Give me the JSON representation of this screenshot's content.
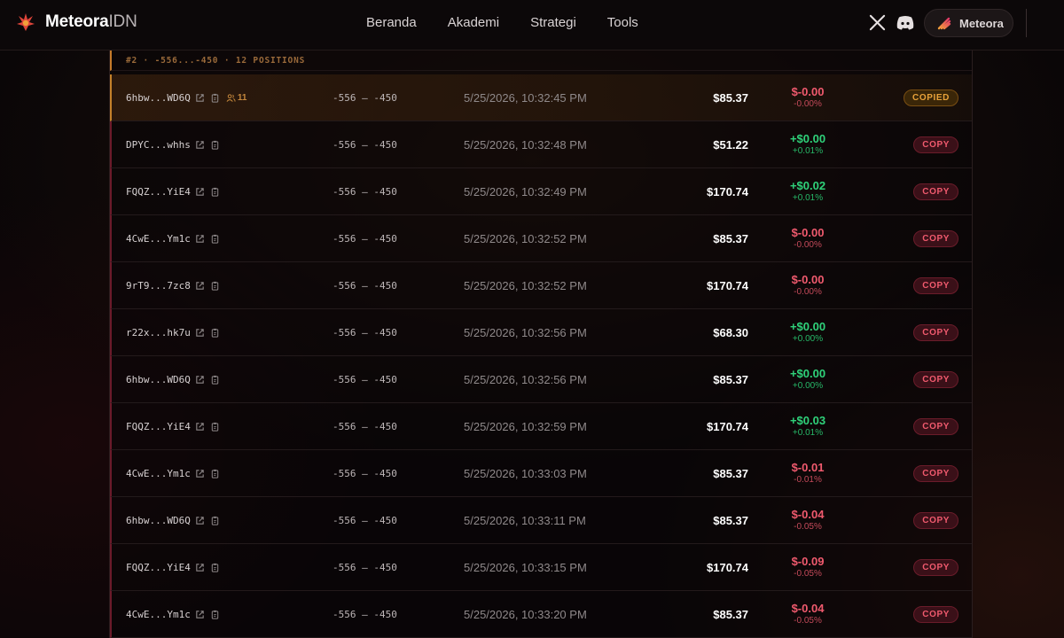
{
  "header": {
    "logo_text": "Meteora",
    "logo_suffix": "IDN",
    "nav": [
      "Beranda",
      "Akademi",
      "Strategi",
      "Tools"
    ],
    "social": [
      "x-icon",
      "discord-icon"
    ],
    "connect_label": "Meteora"
  },
  "group": {
    "label": "#2 · -556...-450 · 12 POSITIONS"
  },
  "colors": {
    "negative": "#f05a6e",
    "positive": "#2fd27a",
    "copied": "#e9a23a",
    "accent_orange": "#c4812a"
  },
  "rows": [
    {
      "wallet": "6hbw...WD6Q",
      "copiers": "11",
      "range": "-556 — -450",
      "time": "5/25/2026, 10:32:45 PM",
      "value": "$85.37",
      "pnl": "$-0.00",
      "pnl_pct": "-0.00%",
      "sign": "neg",
      "button": "COPIED"
    },
    {
      "wallet": "DPYC...whhs",
      "range": "-556 — -450",
      "time": "5/25/2026, 10:32:48 PM",
      "value": "$51.22",
      "pnl": "+$0.00",
      "pnl_pct": "+0.01%",
      "sign": "pos",
      "button": "COPY"
    },
    {
      "wallet": "FQQZ...YiE4",
      "range": "-556 — -450",
      "time": "5/25/2026, 10:32:49 PM",
      "value": "$170.74",
      "pnl": "+$0.02",
      "pnl_pct": "+0.01%",
      "sign": "pos",
      "button": "COPY"
    },
    {
      "wallet": "4CwE...Ym1c",
      "range": "-556 — -450",
      "time": "5/25/2026, 10:32:52 PM",
      "value": "$85.37",
      "pnl": "$-0.00",
      "pnl_pct": "-0.00%",
      "sign": "neg",
      "button": "COPY"
    },
    {
      "wallet": "9rT9...7zc8",
      "range": "-556 — -450",
      "time": "5/25/2026, 10:32:52 PM",
      "value": "$170.74",
      "pnl": "$-0.00",
      "pnl_pct": "-0.00%",
      "sign": "neg",
      "button": "COPY"
    },
    {
      "wallet": "r22x...hk7u",
      "range": "-556 — -450",
      "time": "5/25/2026, 10:32:56 PM",
      "value": "$68.30",
      "pnl": "+$0.00",
      "pnl_pct": "+0.00%",
      "sign": "pos",
      "button": "COPY"
    },
    {
      "wallet": "6hbw...WD6Q",
      "range": "-556 — -450",
      "time": "5/25/2026, 10:32:56 PM",
      "value": "$85.37",
      "pnl": "+$0.00",
      "pnl_pct": "+0.00%",
      "sign": "pos",
      "button": "COPY"
    },
    {
      "wallet": "FQQZ...YiE4",
      "range": "-556 — -450",
      "time": "5/25/2026, 10:32:59 PM",
      "value": "$170.74",
      "pnl": "+$0.03",
      "pnl_pct": "+0.01%",
      "sign": "pos",
      "button": "COPY"
    },
    {
      "wallet": "4CwE...Ym1c",
      "range": "-556 — -450",
      "time": "5/25/2026, 10:33:03 PM",
      "value": "$85.37",
      "pnl": "$-0.01",
      "pnl_pct": "-0.01%",
      "sign": "neg",
      "button": "COPY"
    },
    {
      "wallet": "6hbw...WD6Q",
      "range": "-556 — -450",
      "time": "5/25/2026, 10:33:11 PM",
      "value": "$85.37",
      "pnl": "$-0.04",
      "pnl_pct": "-0.05%",
      "sign": "neg",
      "button": "COPY"
    },
    {
      "wallet": "FQQZ...YiE4",
      "range": "-556 — -450",
      "time": "5/25/2026, 10:33:15 PM",
      "value": "$170.74",
      "pnl": "$-0.09",
      "pnl_pct": "-0.05%",
      "sign": "neg",
      "button": "COPY"
    },
    {
      "wallet": "4CwE...Ym1c",
      "range": "-556 — -450",
      "time": "5/25/2026, 10:33:20 PM",
      "value": "$85.37",
      "pnl": "$-0.04",
      "pnl_pct": "-0.05%",
      "sign": "neg",
      "button": "COPY"
    }
  ]
}
